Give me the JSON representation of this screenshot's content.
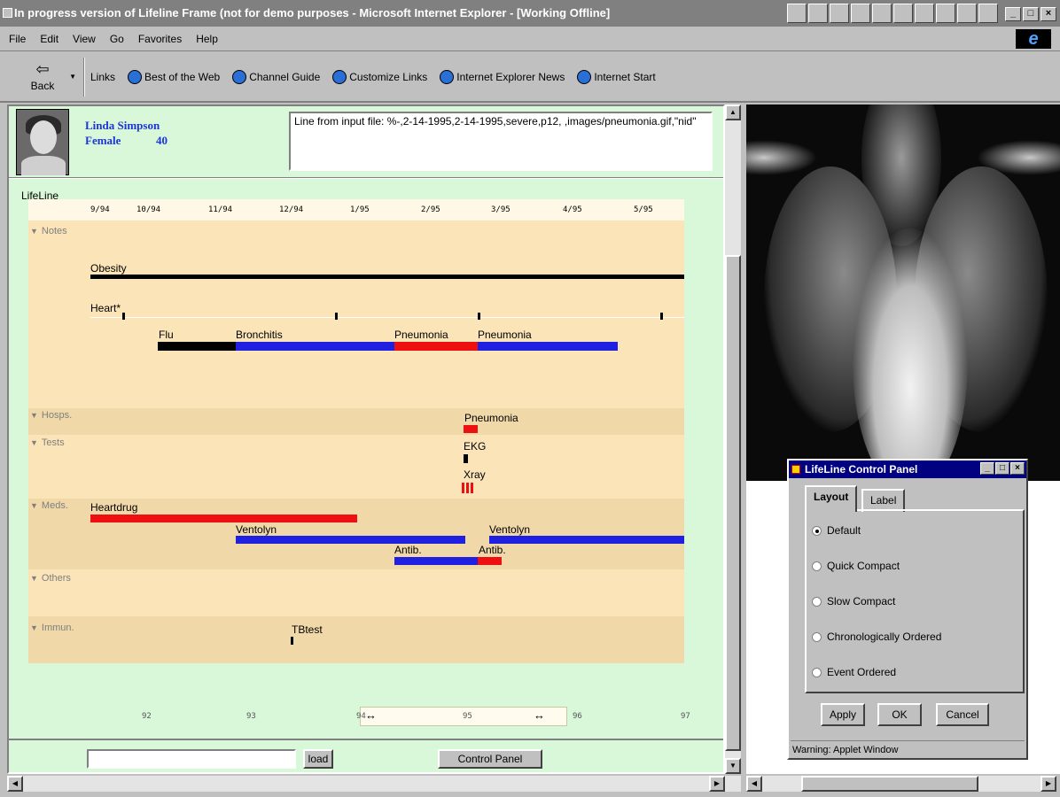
{
  "window": {
    "title": "In progress version of Lifeline Frame (not for demo purposes - Microsoft Internet Explorer - [Working Offline]"
  },
  "menu": {
    "items": [
      "File",
      "Edit",
      "View",
      "Go",
      "Favorites",
      "Help"
    ]
  },
  "toolbar": {
    "back_label": "Back",
    "links_label": "Links",
    "links": [
      "Best of the Web",
      "Channel Guide",
      "Customize Links",
      "Internet Explorer News",
      "Internet Start"
    ]
  },
  "patient": {
    "name": "Linda Simpson",
    "sex": "Female",
    "age": "40"
  },
  "info": {
    "text": "Line from input file:  %-,2-14-1995,2-14-1995,severe,p12, ,images/pneumonia.gif,\"nid\""
  },
  "lifeline": {
    "label": "LifeLine",
    "months": [
      "9/94",
      "10/94",
      "11/94",
      "12/94",
      "1/95",
      "2/95",
      "3/95",
      "4/95",
      "5/95"
    ],
    "categories": [
      "Notes",
      "Hosps.",
      "Tests",
      "Meds.",
      "Others",
      "Immun."
    ],
    "notes": {
      "obesity": "Obesity",
      "heart": "Heart*",
      "flu": "Flu",
      "bronchitis": "Bronchitis",
      "pneumonia1": "Pneumonia",
      "pneumonia2": "Pneumonia"
    },
    "hosps": {
      "pneumonia": "Pneumonia"
    },
    "tests": {
      "ekg": "EKG",
      "xray": "Xray"
    },
    "meds": {
      "heartdrug": "Heartdrug",
      "ventolyn1": "Ventolyn",
      "ventolyn2": "Ventolyn",
      "antib1": "Antib.",
      "antib2": "Antib."
    },
    "immun": {
      "tbtest": "TBtest"
    },
    "overview": {
      "years": [
        "92",
        "93",
        "94",
        "95",
        "96",
        "97"
      ]
    }
  },
  "controls": {
    "load_label": "load",
    "control_panel_label": "Control Panel"
  },
  "colors": {
    "black": "#000000",
    "blue": "#2020e0",
    "red": "#ee1010"
  },
  "control_panel": {
    "title": "LifeLine Control Panel",
    "tabs": [
      "Layout",
      "Label"
    ],
    "active_tab": "Layout",
    "options": [
      "Default",
      "Quick Compact",
      "Slow Compact",
      "Chronologically Ordered",
      "Event Ordered"
    ],
    "selected": "Default",
    "buttons": {
      "apply": "Apply",
      "ok": "OK",
      "cancel": "Cancel"
    },
    "status": "Warning: Applet Window"
  }
}
